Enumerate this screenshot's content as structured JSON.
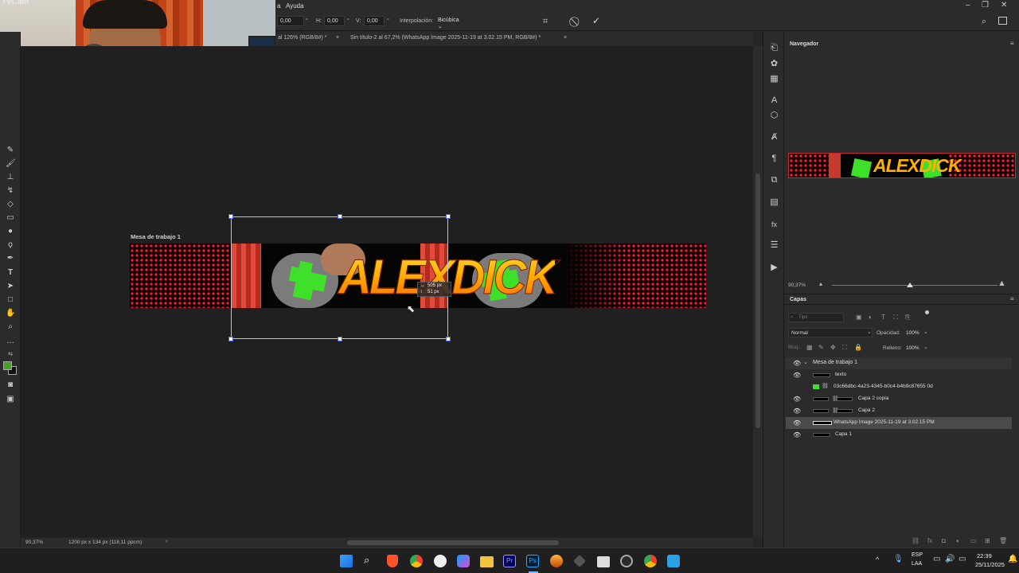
{
  "app": {
    "menu_visible": "a",
    "menu_help": "Ayuda"
  },
  "options_bar": {
    "x_value": "0,00",
    "h_label": "H:",
    "h_value": "0,00",
    "v_label": "V:",
    "v_value": "0,00",
    "interp_label": "Interpolación:",
    "interp_value": "Bicúbica"
  },
  "tabs": [
    {
      "label": "al 126% (RGB/8#) *"
    },
    {
      "label": "Sin título-2 al 67,2% (WhatsApp Image 2025-11-19 at 3.02.15 PM, RGB/8#) *"
    }
  ],
  "webcam": {
    "overlay_text": "TVCam"
  },
  "artboard": {
    "label": "Mesa de trabajo 1",
    "banner_text": "ALEXDICK"
  },
  "transform_tooltip": {
    "width": "505 px",
    "height": "51 px"
  },
  "status": {
    "zoom": "90,37%",
    "doc_info": "1200 px x 134 px (118,11 ppcm)"
  },
  "navigator": {
    "title": "Navegador",
    "zoom": "90,37%",
    "slider_fraction": 0.47
  },
  "layers_panel": {
    "title": "Capas",
    "search_placeholder": "Tipo",
    "blend_mode": "Normal",
    "opacity_label": "Opacidad:",
    "opacity_value": "100%",
    "lock_label": "Bloq.:",
    "fill_label": "Relleno:",
    "fill_value": "100%",
    "group": "Mesa de trabajo 1",
    "layers": [
      {
        "name": "texto",
        "visible": true,
        "selected": false
      },
      {
        "name": "03c66dbc-4a23-4345-b0c4-b4b9c87655 0d",
        "visible": false,
        "selected": false
      },
      {
        "name": "Capa 2 copia",
        "visible": true,
        "selected": false
      },
      {
        "name": "Capa 2",
        "visible": true,
        "selected": false
      },
      {
        "name": "WhatsApp Image 2025-11-19 at 3.02.15 PM",
        "visible": true,
        "selected": true
      },
      {
        "name": "Capa 1",
        "visible": true,
        "selected": false
      }
    ]
  },
  "taskbar": {
    "lang_top": "ESP",
    "lang_bottom": "LAA",
    "time": "22:39",
    "date": "25/11/2025"
  },
  "colors": {
    "accent_green": "#3fe02a",
    "banner_red": "#ff1f3a",
    "selection_blue": "#4a6ad0",
    "text_orange": "#ff9a00"
  }
}
